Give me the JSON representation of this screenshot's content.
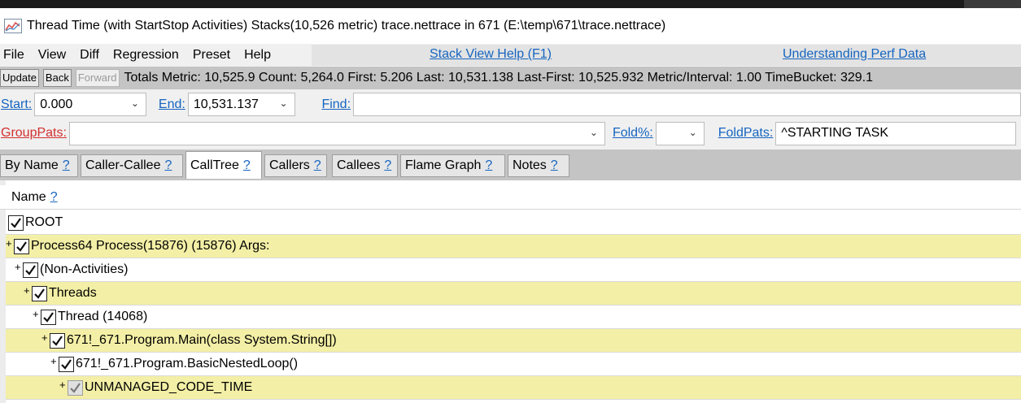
{
  "window": {
    "title": "Thread Time (with StartStop Activities) Stacks(10,526 metric) trace.nettrace in 671 (E:\\temp\\671\\trace.nettrace)",
    "icon": "perfview-chart-icon"
  },
  "menu": {
    "items": [
      "File",
      "View",
      "Diff",
      "Regression",
      "Preset",
      "Help"
    ],
    "help_link": "Stack View Help (F1)",
    "understanding_link": "Understanding Perf Data"
  },
  "toolbar": {
    "update_label": "Update",
    "back_label": "Back",
    "forward_label": "Forward",
    "totals": "Totals Metric: 10,525.9  Count: 5,264.0  First: 5.206 Last: 10,531.138  Last-First: 10,525.932  Metric/Interval: 1.00  TimeBucket: 329.1"
  },
  "filters": {
    "start_label": "Start:",
    "start_value": "0.000",
    "end_label": "End:",
    "end_value": "10,531.137",
    "find_label": "Find:",
    "find_value": "",
    "grouppats_label": "GroupPats:",
    "grouppats_value": "",
    "foldpct_label": "Fold%:",
    "foldpct_value": "",
    "foldpats_label": "FoldPats:",
    "foldpats_value": "^STARTING TASK"
  },
  "tabs": [
    {
      "label": "By Name",
      "help": "?"
    },
    {
      "label": "Caller-Callee",
      "help": "?"
    },
    {
      "label": "CallTree",
      "help": "?",
      "active": true
    },
    {
      "label": "Callers",
      "help": "?"
    },
    {
      "label": "Callees",
      "help": "?"
    },
    {
      "label": "Flame Graph",
      "help": "?"
    },
    {
      "label": "Notes",
      "help": "?"
    }
  ],
  "tree": {
    "column_header": "Name",
    "column_help": "?",
    "rows": [
      {
        "text": "ROOT",
        "depth": 0,
        "expander": "",
        "checked": true,
        "highlight": false
      },
      {
        "text": "Process64 Process(15876) (15876) Args: ",
        "depth": 0,
        "expander": "+",
        "checked": true,
        "highlight": true
      },
      {
        "text": "(Non-Activities)",
        "depth": 1,
        "expander": "+",
        "checked": true,
        "highlight": false
      },
      {
        "text": "Threads",
        "depth": 2,
        "expander": "+",
        "checked": true,
        "highlight": true
      },
      {
        "text": "Thread (14068)",
        "depth": 3,
        "expander": "+",
        "checked": true,
        "highlight": false
      },
      {
        "text": "671!_671.Program.Main(class System.String[])",
        "depth": 4,
        "expander": "+",
        "checked": true,
        "highlight": true
      },
      {
        "text": "671!_671.Program.BasicNestedLoop()",
        "depth": 5,
        "expander": "+",
        "checked": true,
        "highlight": false
      },
      {
        "text": "UNMANAGED_CODE_TIME",
        "depth": 6,
        "expander": "+",
        "checked": true,
        "dimmed": true,
        "highlight": true
      }
    ]
  }
}
